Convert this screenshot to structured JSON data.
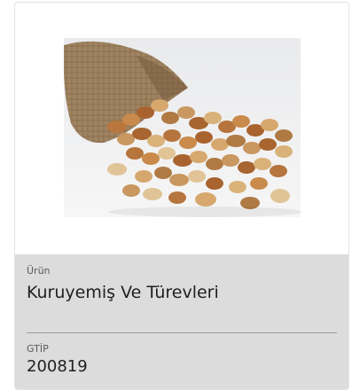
{
  "product": {
    "name_label": "Ürün",
    "name_value": "Kuruyemiş Ve Türevleri",
    "code_label": "GTİP",
    "code_value": "200819",
    "image_icon": "mixed-nuts-sack-photo"
  }
}
